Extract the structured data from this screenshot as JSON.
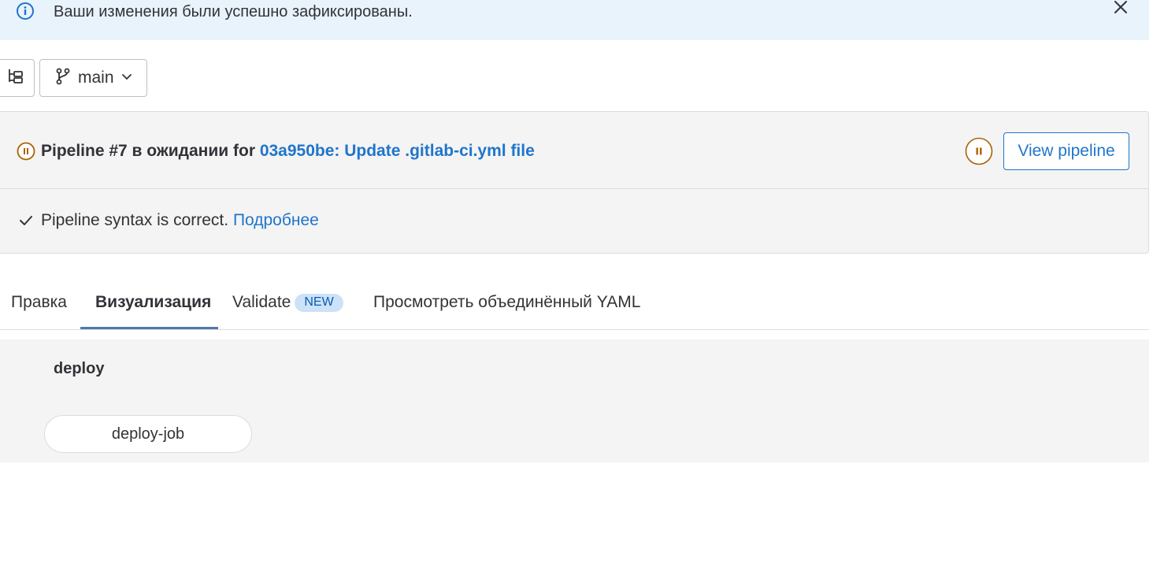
{
  "alert": {
    "message": "Ваши изменения были успешно зафиксированы.",
    "info_icon": "info-circle-icon",
    "close_icon": "close-icon"
  },
  "toolbar": {
    "tree_icon": "file-tree-icon",
    "branch_icon": "branch-icon",
    "branch_name": "main",
    "chevron_icon": "chevron-down-icon"
  },
  "pipeline": {
    "status_icon": "status-paused-icon",
    "prefix": "Pipeline #7 в ожидании for ",
    "commit_link": "03a950be: Update .gitlab-ci.yml file",
    "view_button": "View pipeline",
    "status_color": "#ab6100",
    "syntax_message": "Pipeline syntax is correct. ",
    "syntax_link": "Подробнее"
  },
  "tabs": {
    "items": [
      {
        "label": "Правка"
      },
      {
        "label": "Визуализация"
      },
      {
        "label": "Validate",
        "badge": "NEW"
      },
      {
        "label": "Просмотреть объединённый YAML"
      }
    ],
    "active": "Визуализация"
  },
  "graph": {
    "stage": "deploy",
    "jobs": [
      "deploy-job"
    ]
  },
  "colors": {
    "link": "#1f75cb",
    "alert_bg": "#e9f3fc",
    "panel_bg": "#f4f4f4"
  }
}
